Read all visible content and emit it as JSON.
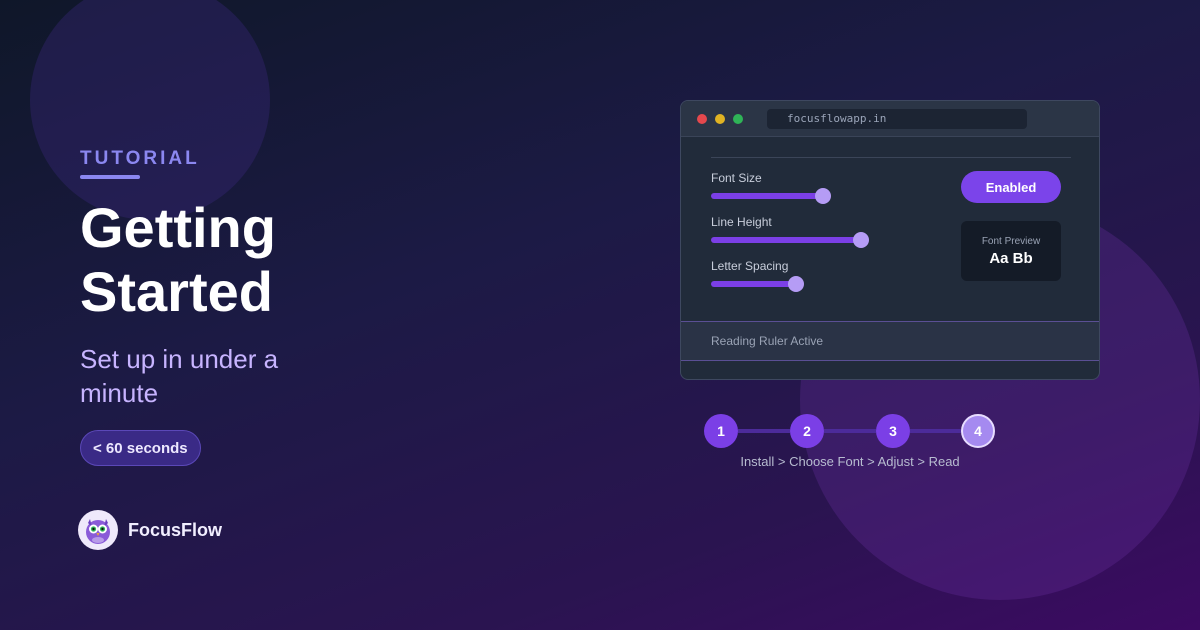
{
  "eyebrow": "TUTORIAL",
  "headline": "Getting Started",
  "subhead": "Set up in under a minute",
  "pill": "< 60 seconds",
  "brand": {
    "name": "FocusFlow",
    "logo_icon": "owl-icon"
  },
  "browser": {
    "url": "focusflowapp.in",
    "controls": [
      {
        "label": "Font Size",
        "level_fraction": 0.71
      },
      {
        "label": "Line Height",
        "level_fraction": 0.95
      },
      {
        "label": "Letter Spacing",
        "level_fraction": 0.54
      }
    ],
    "toggle_label": "Enabled",
    "preview_label": "Font Preview",
    "preview_sample": "Aa Bb",
    "ruler_label": "Reading Ruler Active"
  },
  "steps": {
    "numbers": [
      "1",
      "2",
      "3",
      "4"
    ],
    "current": 4,
    "caption": "Install > Choose Font > Adjust > Read"
  },
  "colors": {
    "accent": "#7b3fe6",
    "eyebrow": "#8b87f0",
    "subhead": "#c7b4ff"
  }
}
